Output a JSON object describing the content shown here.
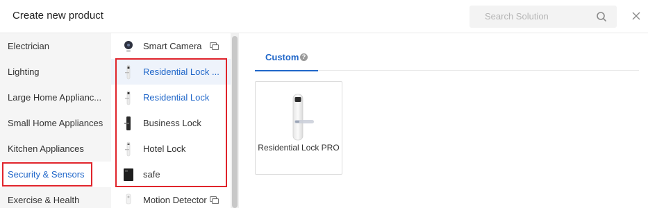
{
  "header": {
    "title": "Create new product",
    "search_placeholder": "Search Solution"
  },
  "categories": [
    {
      "label": "Electrician",
      "active": false
    },
    {
      "label": "Lighting",
      "active": false
    },
    {
      "label": "Large Home Applianc...",
      "active": false
    },
    {
      "label": "Small Home Appliances",
      "active": false
    },
    {
      "label": "Kitchen Appliances",
      "active": false
    },
    {
      "label": "Security & Sensors",
      "active": true
    },
    {
      "label": "Exercise & Health",
      "active": false
    }
  ],
  "products": [
    {
      "label": "Smart Camera",
      "icon": "camera-icon",
      "has_device_icon": true
    },
    {
      "label": "Residential Lock ...",
      "icon": "door-lock-icon",
      "selected": true,
      "highlight": true
    },
    {
      "label": "Residential Lock",
      "icon": "door-lock-icon",
      "highlight": true
    },
    {
      "label": "Business Lock",
      "icon": "door-lock-black-icon"
    },
    {
      "label": "Hotel Lock",
      "icon": "door-lock-icon"
    },
    {
      "label": "safe",
      "icon": "safe-icon"
    },
    {
      "label": "Motion Detector",
      "icon": "motion-detector-icon",
      "has_device_icon": true
    }
  ],
  "tabs": [
    {
      "label": "Custom",
      "active": true,
      "help_icon": "?"
    }
  ],
  "solutions": [
    {
      "label": "Residential Lock PRO",
      "icon": "door-lock-pro-image"
    }
  ],
  "colors": {
    "accent": "#1f66c9",
    "highlight_box": "#e0242b"
  }
}
